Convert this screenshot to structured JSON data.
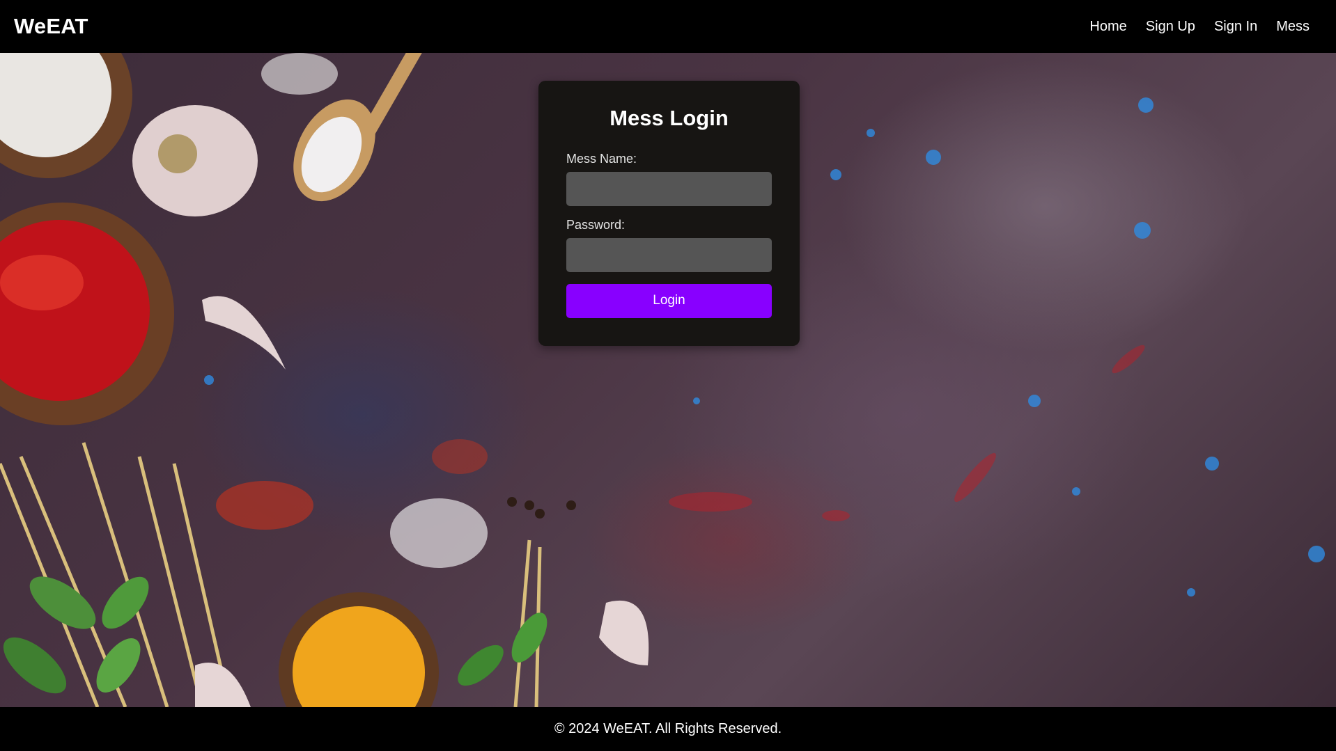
{
  "nav": {
    "brand": "WeEAT",
    "links": [
      {
        "label": "Home"
      },
      {
        "label": "Sign Up"
      },
      {
        "label": "Sign In"
      },
      {
        "label": "Mess"
      }
    ]
  },
  "login": {
    "title": "Mess Login",
    "mess_name_label": "Mess Name:",
    "mess_name_value": "",
    "password_label": "Password:",
    "password_value": "",
    "submit_label": "Login"
  },
  "footer": {
    "text": "© 2024 WeEAT. All Rights Reserved."
  },
  "colors": {
    "nav_background": "#000000",
    "card_background": "#171513",
    "input_background": "#555555",
    "button_accent": "#8800ff"
  }
}
